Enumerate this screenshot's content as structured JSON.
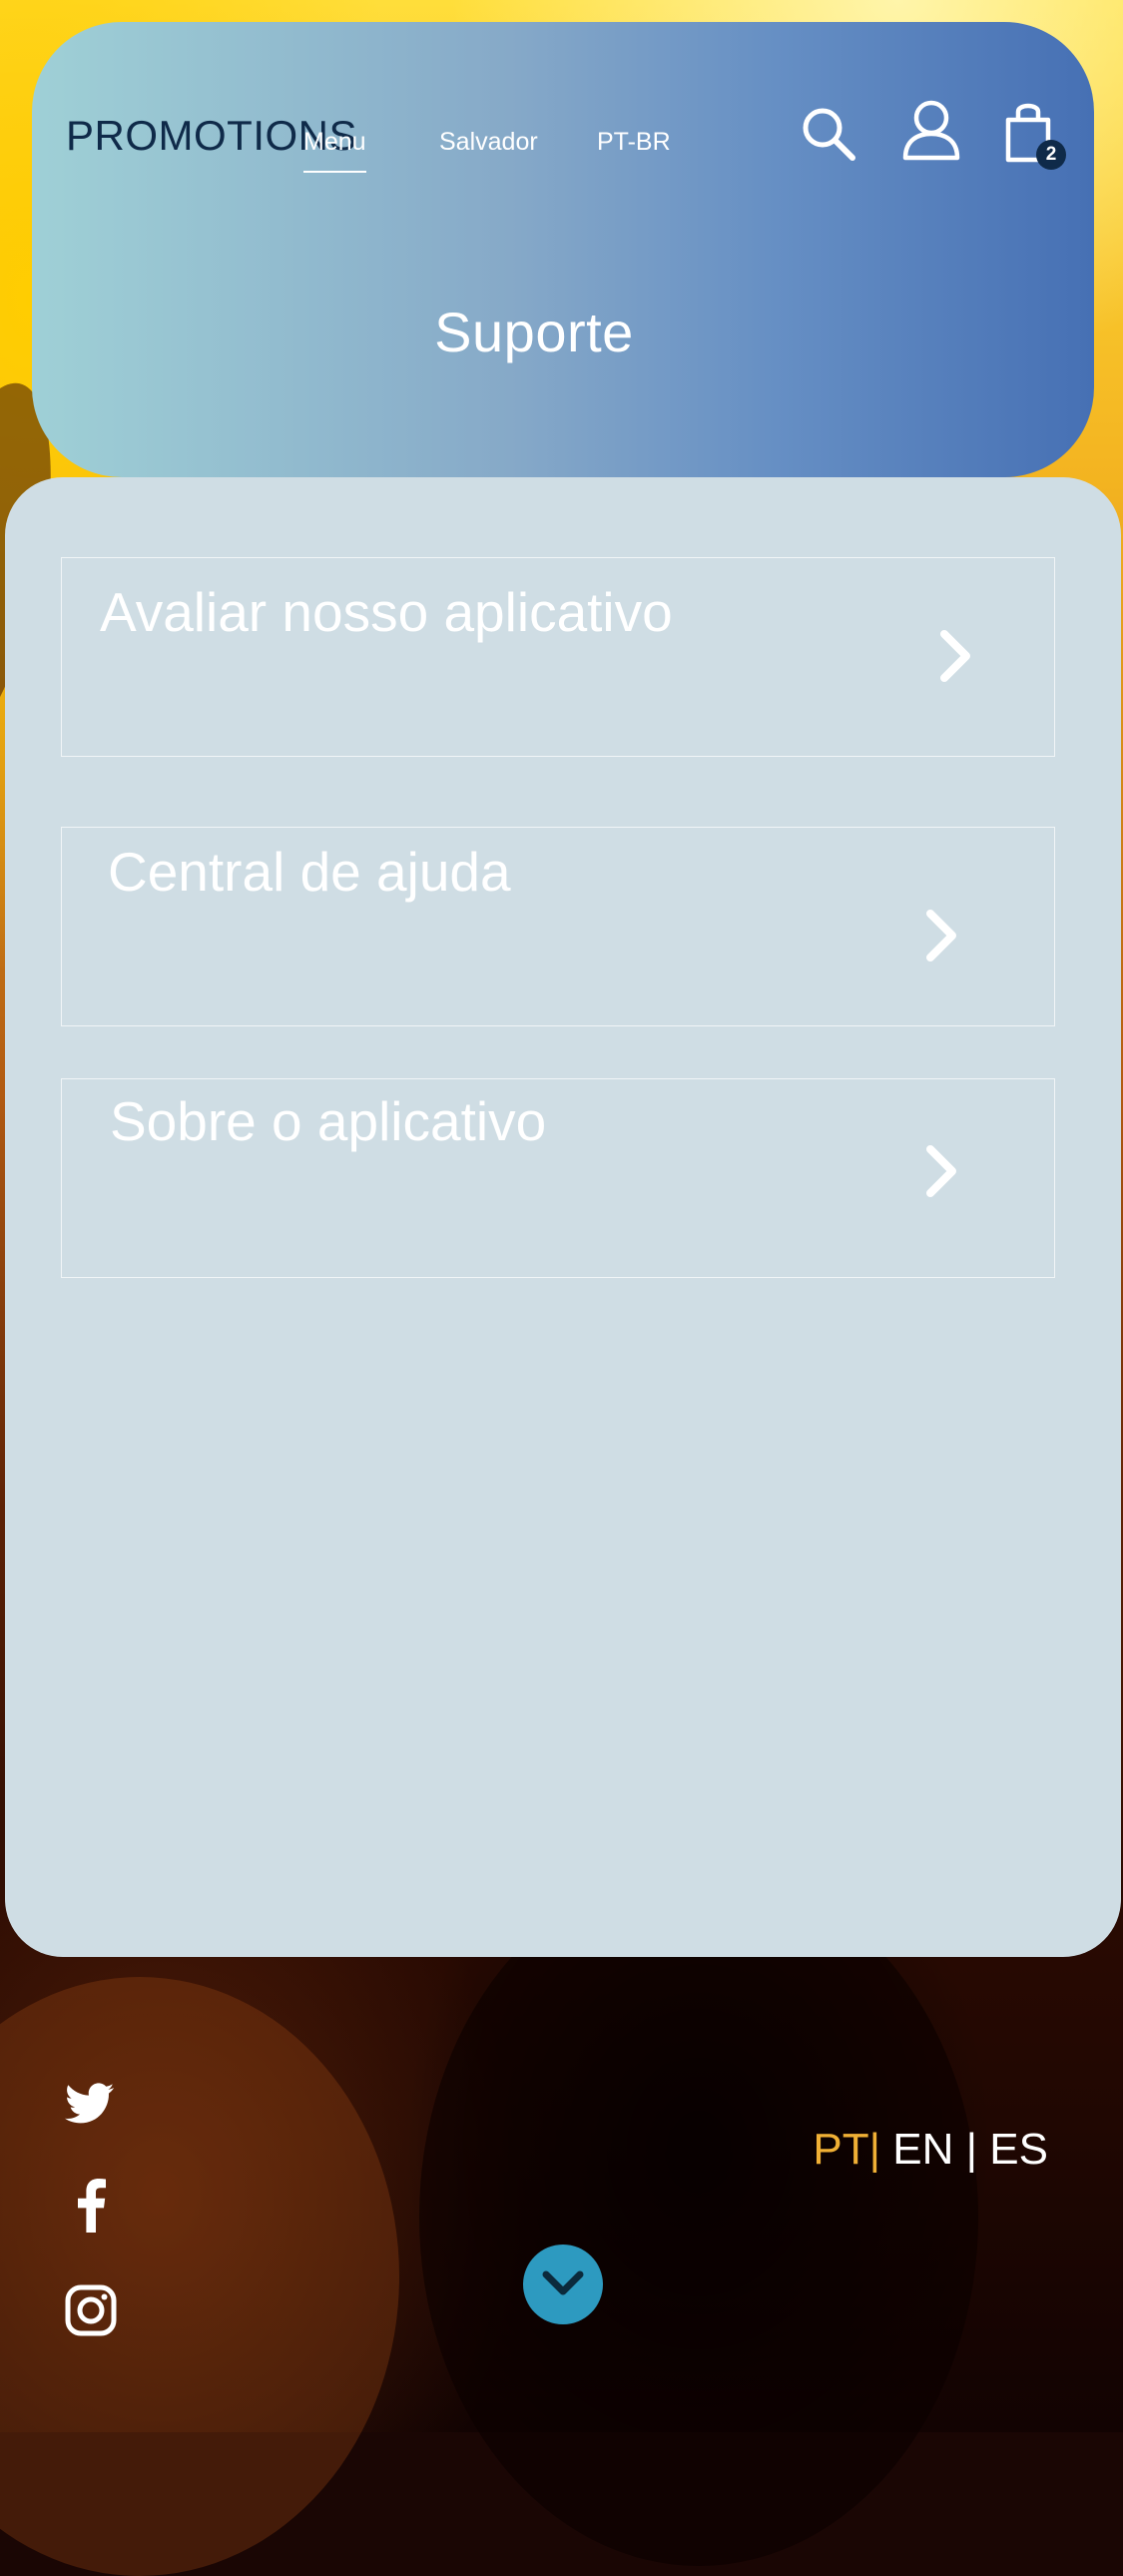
{
  "header": {
    "brand": "PROMOTIONS",
    "nav": {
      "menu": "Menu",
      "city": "Salvador",
      "language": "PT-BR"
    },
    "cart_count": "2",
    "title": "Suporte"
  },
  "support_items": [
    {
      "label": "Avaliar nosso aplicativo"
    },
    {
      "label": "Central de ajuda"
    },
    {
      "label": "Sobre o aplicativo"
    }
  ],
  "footer": {
    "languages": {
      "pt": "PT",
      "en": "EN",
      "es": "ES"
    }
  },
  "icons": {
    "search": "search-icon",
    "account": "user-icon",
    "cart": "shopping-bag-icon",
    "chevron": "chevron-right-icon",
    "twitter": "twitter-icon",
    "facebook": "facebook-icon",
    "instagram": "instagram-icon",
    "scroll": "chevron-down-icon"
  },
  "colors": {
    "panel": "#cfdde4",
    "brand_text": "#0f2a49",
    "accent_language": "#f0b035",
    "scroll_button": "#2d9ac0"
  }
}
